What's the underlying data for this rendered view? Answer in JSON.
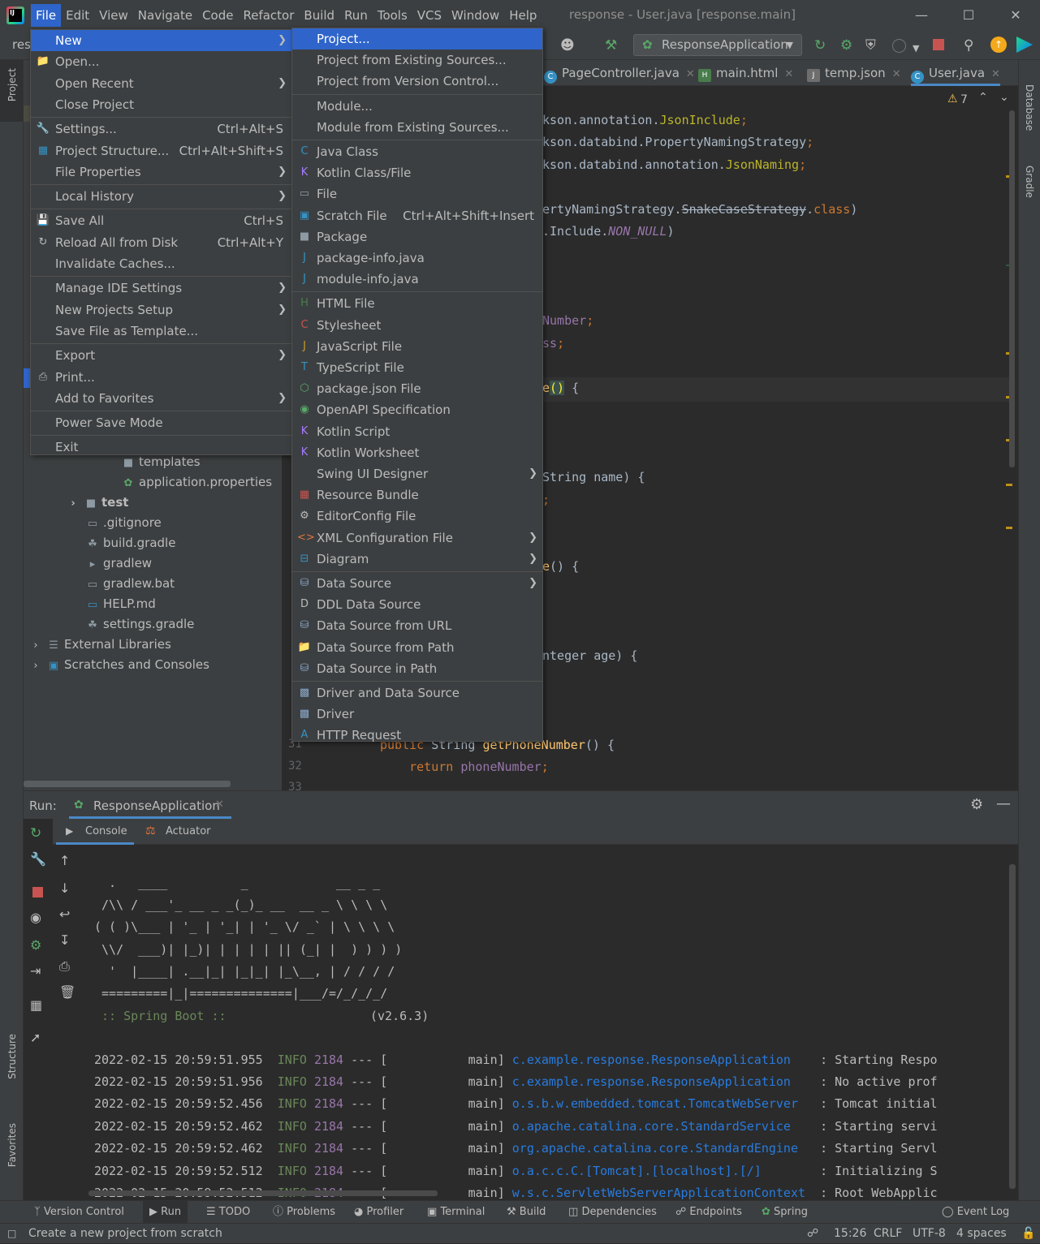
{
  "menubar": {
    "items": [
      "File",
      "Edit",
      "View",
      "Navigate",
      "Code",
      "Refactor",
      "Build",
      "Run",
      "Tools",
      "VCS",
      "Window",
      "Help"
    ],
    "title": "response - User.java [response.main]"
  },
  "toolbar": {
    "project_short": "res",
    "run_config": "ResponseApplication"
  },
  "file_menu": [
    {
      "label": "New",
      "arrow": true,
      "highlight": true
    },
    {
      "label": "Open...",
      "icon": "folder-icon"
    },
    {
      "label": "Open Recent",
      "arrow": true
    },
    {
      "label": "Close Project"
    },
    {
      "label": "Settings...",
      "shortcut": "Ctrl+Alt+S",
      "icon": "wrench-icon"
    },
    {
      "label": "Project Structure...",
      "shortcut": "Ctrl+Alt+Shift+S",
      "icon": "project-structure-icon"
    },
    {
      "label": "File Properties",
      "arrow": true
    },
    {
      "label": "Local History",
      "arrow": true
    },
    {
      "label": "Save All",
      "shortcut": "Ctrl+S",
      "icon": "save-icon"
    },
    {
      "label": "Reload All from Disk",
      "shortcut": "Ctrl+Alt+Y",
      "icon": "reload-icon"
    },
    {
      "label": "Invalidate Caches..."
    },
    {
      "label": "Manage IDE Settings",
      "arrow": true
    },
    {
      "label": "New Projects Setup",
      "arrow": true
    },
    {
      "label": "Save File as Template..."
    },
    {
      "label": "Export",
      "arrow": true
    },
    {
      "label": "Print...",
      "icon": "print-icon"
    },
    {
      "label": "Add to Favorites",
      "arrow": true
    },
    {
      "label": "Power Save Mode"
    },
    {
      "label": "Exit"
    }
  ],
  "new_menu": [
    {
      "label": "Project...",
      "highlight": true
    },
    {
      "label": "Project from Existing Sources..."
    },
    {
      "label": "Project from Version Control..."
    },
    {
      "label": "Module..."
    },
    {
      "label": "Module from Existing Sources..."
    },
    {
      "label": "Java Class",
      "icon": "java-class-icon"
    },
    {
      "label": "Kotlin Class/File",
      "icon": "kotlin-icon"
    },
    {
      "label": "File",
      "icon": "file-icon"
    },
    {
      "label": "Scratch File",
      "shortcut": "Ctrl+Alt+Shift+Insert",
      "icon": "scratch-file-icon"
    },
    {
      "label": "Package",
      "icon": "package-icon"
    },
    {
      "label": "package-info.java",
      "icon": "java-file-icon"
    },
    {
      "label": "module-info.java",
      "icon": "java-file-icon"
    },
    {
      "label": "HTML File",
      "icon": "html-icon"
    },
    {
      "label": "Stylesheet",
      "icon": "css-icon"
    },
    {
      "label": "JavaScript File",
      "icon": "js-icon"
    },
    {
      "label": "TypeScript File",
      "icon": "ts-icon"
    },
    {
      "label": "package.json File",
      "icon": "nodejs-icon"
    },
    {
      "label": "OpenAPI Specification",
      "icon": "openapi-icon"
    },
    {
      "label": "Kotlin Script",
      "icon": "kotlin-icon"
    },
    {
      "label": "Kotlin Worksheet",
      "icon": "kotlin-icon"
    },
    {
      "label": "Swing UI Designer",
      "arrow": true
    },
    {
      "label": "Resource Bundle",
      "icon": "resource-bundle-icon"
    },
    {
      "label": "EditorConfig File",
      "icon": "gear-icon"
    },
    {
      "label": "XML Configuration File",
      "arrow": true,
      "icon": "xml-icon"
    },
    {
      "label": "Diagram",
      "arrow": true,
      "icon": "diagram-icon"
    },
    {
      "label": "Data Source",
      "arrow": true,
      "icon": "database-icon"
    },
    {
      "label": "DDL Data Source",
      "icon": "ddl-icon"
    },
    {
      "label": "Data Source from URL",
      "icon": "database-url-icon"
    },
    {
      "label": "Data Source from Path",
      "icon": "folder-icon"
    },
    {
      "label": "Data Source in Path",
      "icon": "database-icon"
    },
    {
      "label": "Driver and Data Source",
      "icon": "driver-icon"
    },
    {
      "label": "Driver",
      "icon": "driver-icon"
    },
    {
      "label": "HTTP Request",
      "icon": "api-icon"
    }
  ],
  "project_tree": [
    {
      "label": "templates",
      "icon": "folder-icon"
    },
    {
      "label": "application.properties",
      "icon": "spring-icon"
    },
    {
      "label": "test",
      "icon": "folder-icon",
      "bold": true
    },
    {
      "label": ".gitignore",
      "icon": "file-icon"
    },
    {
      "label": "build.gradle",
      "icon": "gradle-icon"
    },
    {
      "label": "gradlew",
      "icon": "terminal-icon"
    },
    {
      "label": "gradlew.bat",
      "icon": "file-icon"
    },
    {
      "label": "HELP.md",
      "icon": "markdown-icon"
    },
    {
      "label": "settings.gradle",
      "icon": "gradle-icon"
    },
    {
      "label": "External Libraries",
      "icon": "library-icon"
    },
    {
      "label": "Scratches and Consoles",
      "icon": "scratch-icon"
    }
  ],
  "editor_tabs": [
    {
      "label": "PageController.java",
      "icon": "C"
    },
    {
      "label": "main.html",
      "icon": "H"
    },
    {
      "label": "temp.json",
      "icon": "J"
    },
    {
      "label": "User.java",
      "icon": "C",
      "selected": true
    }
  ],
  "editor": {
    "warnings": "7",
    "gutter_lines": [
      "31",
      "32",
      "33"
    ]
  },
  "side_labels": {
    "project": "Project",
    "structure": "Structure",
    "favorites": "Favorites",
    "database": "Database",
    "gradle": "Gradle"
  },
  "run_panel": {
    "label": "Run:",
    "config": "ResponseApplication",
    "tabs": [
      "Console",
      "Actuator"
    ]
  },
  "console": {
    "banner": [
      "  .   ____          _            __ _ _",
      " /\\\\ / ___'_ __ _ _(_)_ __  __ _ \\ \\ \\ \\",
      "( ( )\\___ | '_ | '_| | '_ \\/ _` | \\ \\ \\ \\",
      " \\\\/  ___)| |_)| | | | | || (_| |  ) ) ) )",
      "  '  |____| .__|_| |_|_| |_\\__, | / / / /",
      " =========|_|==============|___/=/_/_/_/"
    ],
    "spring_boot": " :: Spring Boot ::",
    "version": "(v2.6.3)",
    "logs": [
      {
        "ts": "2022-02-15 20:59:51.955",
        "level": "INFO",
        "pid": "2184",
        "sep": "--- [",
        "thread": "main]",
        "logger": "c.example.response.ResponseApplication  ",
        "msg": ": Starting Respo"
      },
      {
        "ts": "2022-02-15 20:59:51.956",
        "level": "INFO",
        "pid": "2184",
        "sep": "--- [",
        "thread": "main]",
        "logger": "c.example.response.ResponseApplication  ",
        "msg": ": No active prof"
      },
      {
        "ts": "2022-02-15 20:59:52.456",
        "level": "INFO",
        "pid": "2184",
        "sep": "--- [",
        "thread": "main]",
        "logger": "o.s.b.w.embedded.tomcat.TomcatWebServer ",
        "msg": ": Tomcat initial"
      },
      {
        "ts": "2022-02-15 20:59:52.462",
        "level": "INFO",
        "pid": "2184",
        "sep": "--- [",
        "thread": "main]",
        "logger": "o.apache.catalina.core.StandardService  ",
        "msg": ": Starting servi"
      },
      {
        "ts": "2022-02-15 20:59:52.462",
        "level": "INFO",
        "pid": "2184",
        "sep": "--- [",
        "thread": "main]",
        "logger": "org.apache.catalina.core.StandardEngine ",
        "msg": ": Starting Servl"
      },
      {
        "ts": "2022-02-15 20:59:52.512",
        "level": "INFO",
        "pid": "2184",
        "sep": "--- [",
        "thread": "main]",
        "logger": "o.a.c.c.C.[Tomcat].[localhost].[/]      ",
        "msg": ": Initializing S"
      },
      {
        "ts": "2022-02-15 20:59:52.512",
        "level": "INFO",
        "pid": "2184",
        "sep": "--- [",
        "thread": "main]",
        "logger": "w.s.c.ServletWebServerApplicationContext",
        "msg": ": Root WebApplic"
      }
    ]
  },
  "bottom_tools": [
    "Version Control",
    "Run",
    "TODO",
    "Problems",
    "Profiler",
    "Terminal",
    "Build",
    "Dependencies",
    "Endpoints",
    "Spring",
    "Event Log"
  ],
  "status": {
    "message": "Create a new project from scratch",
    "time": "15:26",
    "line_sep": "CRLF",
    "encoding": "UTF-8",
    "indent": "4 spaces"
  }
}
